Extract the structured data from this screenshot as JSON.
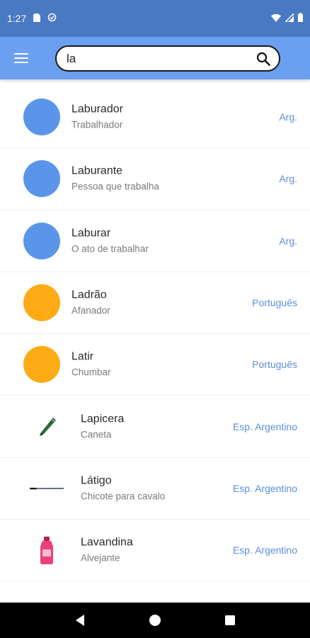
{
  "status_bar": {
    "time": "1:27",
    "left_icons": [
      "sim-card-icon",
      "sync-icon"
    ],
    "right_icons": [
      "wifi-icon",
      "signal-icon",
      "battery-icon"
    ]
  },
  "app_bar": {
    "menu_icon": "hamburger-menu-icon",
    "search": {
      "value": "la",
      "icon": "search-icon"
    },
    "color": "#6b9ff0"
  },
  "colors": {
    "argentina_avatar": "#5a95ea",
    "portugues_avatar": "#fcab14",
    "lang_text": "#5b8fd9"
  },
  "results": [
    {
      "word": "Laburador",
      "meaning": "Trabalhador",
      "lang": "Arg.",
      "visual": "circle-blue"
    },
    {
      "word": "Laburante",
      "meaning": "Pessoa que trabalha",
      "lang": "Arg.",
      "visual": "circle-blue"
    },
    {
      "word": "Laburar",
      "meaning": "O ato de trabalhar",
      "lang": "Arg.",
      "visual": "circle-blue"
    },
    {
      "word": "Ladrão",
      "meaning": "Afanador",
      "lang": "Português",
      "visual": "circle-orange"
    },
    {
      "word": "Latir",
      "meaning": "Chumbar",
      "lang": "Português",
      "visual": "circle-orange"
    },
    {
      "word": "Lapicera",
      "meaning": "Caneta",
      "lang": "Esp. Argentino",
      "visual": "pen-icon"
    },
    {
      "word": "Látigo",
      "meaning": "Chicote para cavalo",
      "lang": "Esp. Argentino",
      "visual": "whip-icon"
    },
    {
      "word": "Lavandina",
      "meaning": "Alvejante",
      "lang": "Esp. Argentino",
      "visual": "bleach-bottle-icon"
    }
  ],
  "nav_bar": [
    "back-icon",
    "home-icon",
    "recents-icon"
  ]
}
